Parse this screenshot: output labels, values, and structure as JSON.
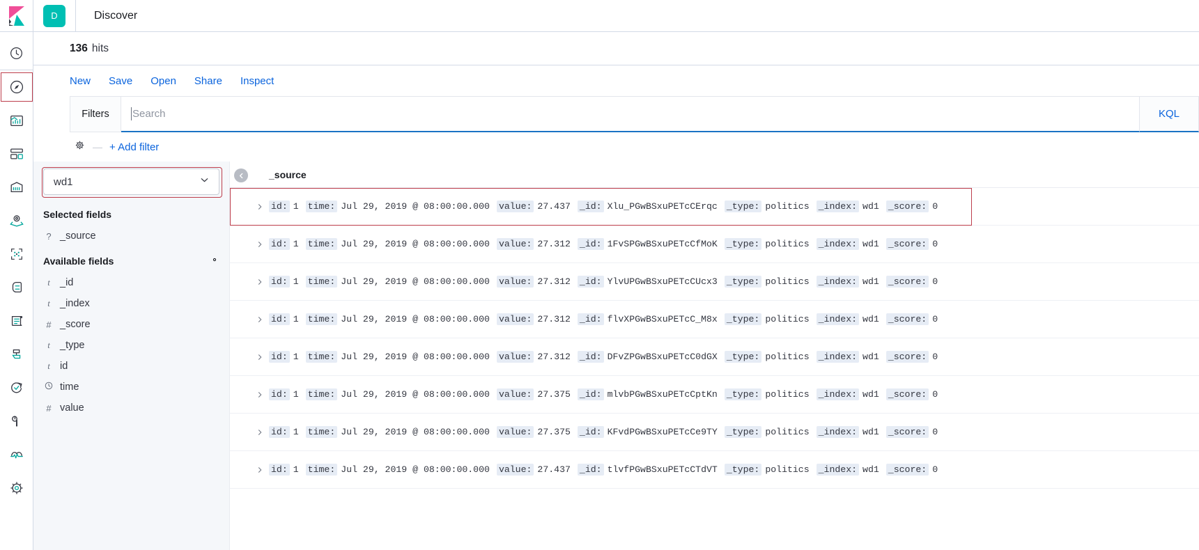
{
  "brand": {
    "logo_name": "kibana-logo",
    "accent_teal": "#00bfb3",
    "accent_pink": "#f04e98",
    "link_blue": "#0b64dd",
    "highlight_red": "#bd3d4b"
  },
  "header": {
    "app_badge": "D",
    "title": "Discover"
  },
  "hits": {
    "count": "136",
    "label": "hits"
  },
  "menu": {
    "items": [
      {
        "label": "New",
        "name": "new"
      },
      {
        "label": "Save",
        "name": "save"
      },
      {
        "label": "Open",
        "name": "open"
      },
      {
        "label": "Share",
        "name": "share"
      },
      {
        "label": "Inspect",
        "name": "inspect"
      }
    ]
  },
  "query": {
    "filters_tab": "Filters",
    "search_value": "",
    "search_placeholder": "Search",
    "language": "KQL",
    "add_filter": "+ Add filter",
    "add_filter_dash": "—"
  },
  "sidebar_nav": {
    "items": [
      {
        "name": "recently-viewed-icon",
        "label": "Recently viewed",
        "active": false
      },
      {
        "name": "discover-icon",
        "label": "Discover",
        "active": true
      },
      {
        "name": "visualize-icon",
        "label": "Visualize",
        "active": false
      },
      {
        "name": "dashboard-icon",
        "label": "Dashboard",
        "active": false
      },
      {
        "name": "canvas-icon",
        "label": "Canvas",
        "active": false
      },
      {
        "name": "maps-icon",
        "label": "Maps",
        "active": false
      },
      {
        "name": "machine-learning-icon",
        "label": "Machine Learning",
        "active": false
      },
      {
        "name": "infrastructure-icon",
        "label": "Infrastructure",
        "active": false
      },
      {
        "name": "logs-icon",
        "label": "Logs",
        "active": false
      },
      {
        "name": "apm-icon",
        "label": "APM",
        "active": false
      },
      {
        "name": "uptime-icon",
        "label": "Uptime",
        "active": false
      },
      {
        "name": "dev-tools-icon",
        "label": "Dev Tools",
        "active": false
      },
      {
        "name": "monitoring-icon",
        "label": "Monitoring",
        "active": false
      },
      {
        "name": "management-icon",
        "label": "Management",
        "active": false
      }
    ]
  },
  "fields_panel": {
    "index_pattern": "wd1",
    "selected_fields_heading": "Selected fields",
    "available_fields_heading": "Available fields",
    "selected_fields": [
      {
        "type": "?",
        "name": "_source"
      }
    ],
    "available_fields": [
      {
        "type": "t",
        "name": "_id"
      },
      {
        "type": "t",
        "name": "_index"
      },
      {
        "type": "#",
        "name": "_score"
      },
      {
        "type": "t",
        "name": "_type"
      },
      {
        "type": "t",
        "name": "id"
      },
      {
        "type": "clock",
        "name": "time"
      },
      {
        "type": "#",
        "name": "value"
      }
    ]
  },
  "docs_table": {
    "column_header": "_source",
    "collapse_button": "collapse-sidebar",
    "field_order": [
      "id",
      "time",
      "value",
      "_id",
      "_type",
      "_index",
      "_score"
    ],
    "rows": [
      {
        "highlight": true,
        "id": "1",
        "time": "Jul 29, 2019 @ 08:00:00.000",
        "value": "27.437",
        "_id": "Xlu_PGwBSxuPETcCErqc",
        "_type": "politics",
        "_index": "wd1",
        "_score": "0"
      },
      {
        "highlight": false,
        "id": "1",
        "time": "Jul 29, 2019 @ 08:00:00.000",
        "value": "27.312",
        "_id": "1FvSPGwBSxuPETcCfMoK",
        "_type": "politics",
        "_index": "wd1",
        "_score": "0"
      },
      {
        "highlight": false,
        "id": "1",
        "time": "Jul 29, 2019 @ 08:00:00.000",
        "value": "27.312",
        "_id": "YlvUPGwBSxuPETcCUcx3",
        "_type": "politics",
        "_index": "wd1",
        "_score": "0"
      },
      {
        "highlight": false,
        "id": "1",
        "time": "Jul 29, 2019 @ 08:00:00.000",
        "value": "27.312",
        "_id": "flvXPGwBSxuPETcC_M8x",
        "_type": "politics",
        "_index": "wd1",
        "_score": "0"
      },
      {
        "highlight": false,
        "id": "1",
        "time": "Jul 29, 2019 @ 08:00:00.000",
        "value": "27.312",
        "_id": "DFvZPGwBSxuPETcC0dGX",
        "_type": "politics",
        "_index": "wd1",
        "_score": "0"
      },
      {
        "highlight": false,
        "id": "1",
        "time": "Jul 29, 2019 @ 08:00:00.000",
        "value": "27.375",
        "_id": "mlvbPGwBSxuPETcCptKn",
        "_type": "politics",
        "_index": "wd1",
        "_score": "0"
      },
      {
        "highlight": false,
        "id": "1",
        "time": "Jul 29, 2019 @ 08:00:00.000",
        "value": "27.375",
        "_id": "KFvdPGwBSxuPETcCe9TY",
        "_type": "politics",
        "_index": "wd1",
        "_score": "0"
      },
      {
        "highlight": false,
        "id": "1",
        "time": "Jul 29, 2019 @ 08:00:00.000",
        "value": "27.437",
        "_id": "tlvfPGwBSxuPETcCTdVT",
        "_type": "politics",
        "_index": "wd1",
        "_score": "0"
      }
    ]
  }
}
